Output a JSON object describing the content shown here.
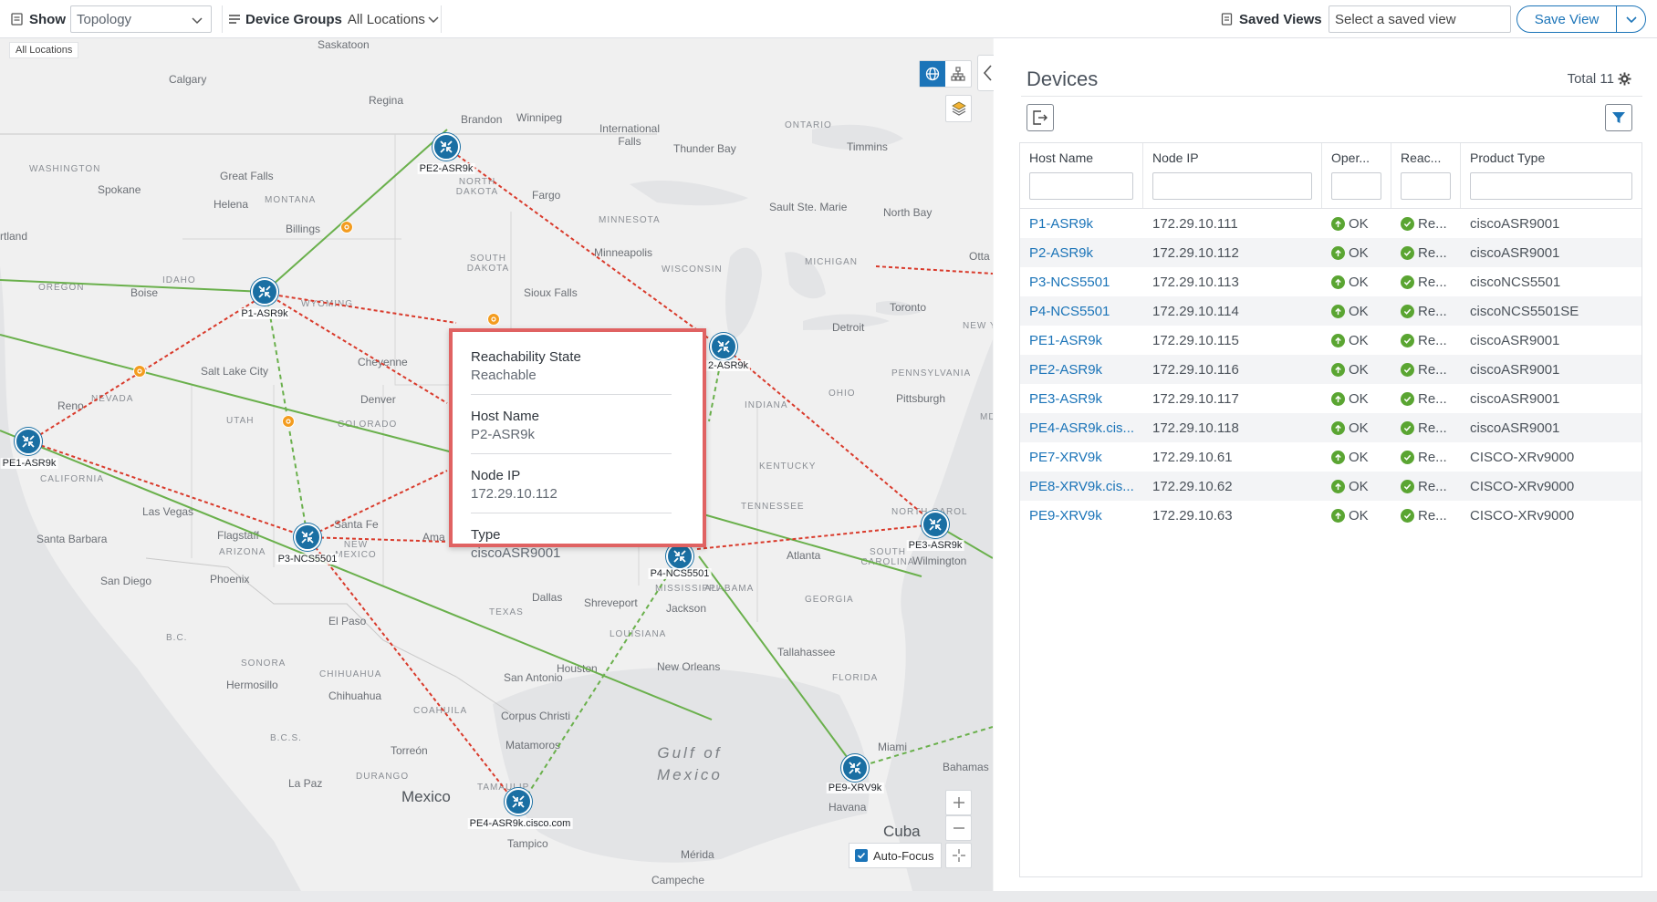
{
  "toolbar": {
    "show_label": "Show",
    "show_value": "Topology",
    "device_groups_label": "Device Groups",
    "device_groups_value": "All Locations",
    "saved_views_label": "Saved Views",
    "saved_view_placeholder": "Select a saved view",
    "save_view_label": "Save View"
  },
  "map": {
    "all_locations_badge": "All Locations",
    "auto_focus_label": "Auto-Focus",
    "auto_focus_checked": true,
    "places": {
      "saskatoon": "Saskatoon",
      "calgary": "Calgary",
      "regina": "Regina",
      "brandon": "Brandon",
      "winnipeg": "Winnipeg",
      "ontario": "ONTARIO",
      "intl_falls": "International Falls",
      "thunder_bay": "Thunder Bay",
      "timmins": "Timmins",
      "washington": "WASHINGTON",
      "spokane": "Spokane",
      "great_falls": "Great Falls",
      "helena": "Helena",
      "montana": "MONTANA",
      "north_dakota": "NORTH DAKOTA",
      "fargo": "Fargo",
      "minnesota": "MINNESOTA",
      "sault": "Sault Ste. Marie",
      "north_bay": "North Bay",
      "billings": "Billings",
      "portland": "rtland",
      "ottawa": "Otta",
      "oregon": "OREGON",
      "idaho": "IDAHO",
      "boise": "Boise",
      "wyoming": "WYOMING",
      "south_dakota": "SOUTH DAKOTA",
      "sioux_falls": "Sioux Falls",
      "minneapolis": "Minneapolis",
      "wisconsin": "WISCONSIN",
      "michigan": "MICHIGAN",
      "toronto": "Toronto",
      "detroit": "Detroit",
      "new_y": "NEW Y",
      "salt_lake": "Salt Lake City",
      "cheyenne": "Cheyenne",
      "nevada": "NEVADA",
      "reno": "Reno",
      "utah": "UTAH",
      "denver": "Denver",
      "colorado": "COLORADO",
      "pennsylvania": "PENNSYLVANIA",
      "ohio": "OHIO",
      "pittsburgh": "Pittsburgh",
      "indiana": "INDIANA",
      "md": "MD",
      "kentucky": "KENTUCKY",
      "california": "CALIFORNIA",
      "las_vegas": "Las Vegas",
      "flagstaff": "Flagstaff",
      "arizona": "ARIZONA",
      "santa_fe": "Santa Fe",
      "new_mexico": "NEW MEXICO",
      "amarillo": "Ama",
      "tennessee": "TENNESSEE",
      "north_carolina": "NORTH CAROL",
      "santa_barbara": "Santa Barbara",
      "phoenix": "Phoenix",
      "san_diego": "San Diego",
      "atlanta": "Atlanta",
      "south_carolina": "SOUTH CAROLINA",
      "wilmington": "Wilmington",
      "alabama": "ALABAMA",
      "mississippi": "MISSISSIPPI",
      "dallas": "Dallas",
      "shreveport": "Shreveport",
      "jackson": "Jackson",
      "georgia": "GEORGIA",
      "el_paso": "El Paso",
      "texas": "TEXAS",
      "louisiana": "LOUISIANA",
      "tallahassee": "Tallahassee",
      "bc": "B.C.",
      "sonora": "SONORA",
      "chihuahua_state": "CHIHUAHUA",
      "houston": "Houston",
      "new_orleans": "New Orleans",
      "hermosillo": "Hermosillo",
      "chihuahua": "Chihuahua",
      "san_antonio": "San Antonio",
      "florida": "FLORIDA",
      "coahuila": "COAHUILA",
      "corpus": "Corpus Christi",
      "gulf": "Gulf of\nMexico",
      "bcs": "B.C.S.",
      "torreon": "Torreón",
      "matamoros": "Matamoros",
      "miami": "Miami",
      "bahamas": "Bahamas",
      "durango": "DURANGO",
      "la_paz": "La Paz",
      "mexico": "Mexico",
      "tamaulipas": "TAMAULIP",
      "havana": "Havana",
      "cuba": "Cuba",
      "tampico": "Tampico",
      "merida": "Mérida",
      "campeche": "Campeche"
    },
    "nodes": [
      {
        "id": "pe2",
        "label": "PE2-ASR9k"
      },
      {
        "id": "p1",
        "label": "P1-ASR9k"
      },
      {
        "id": "p2",
        "label": "2-ASR9k"
      },
      {
        "id": "pe1",
        "label": "PE1-ASR9k"
      },
      {
        "id": "p3",
        "label": "P3-NCS5501"
      },
      {
        "id": "p4",
        "label": "P4-NCS5501"
      },
      {
        "id": "pe3",
        "label": "PE3-ASR9k"
      },
      {
        "id": "pe9",
        "label": "PE9-XRV9k"
      },
      {
        "id": "pe4",
        "label": "PE4-ASR9k.cisco.com"
      }
    ],
    "tooltip": [
      {
        "key": "Reachability State",
        "value": "Reachable"
      },
      {
        "key": "Host Name",
        "value": "P2-ASR9k"
      },
      {
        "key": "Node IP",
        "value": "172.29.10.112"
      },
      {
        "key": "Type",
        "value": "ciscoASR9001"
      }
    ]
  },
  "devices": {
    "title": "Devices",
    "total_label": "Total 11",
    "columns": [
      "Host Name",
      "Node IP",
      "Oper...",
      "Reac...",
      "Product Type"
    ],
    "rows": [
      {
        "host": "P1-ASR9k",
        "ip": "172.29.10.111",
        "oper": "OK",
        "reach": "Re...",
        "type": "ciscoASR9001"
      },
      {
        "host": "P2-ASR9k",
        "ip": "172.29.10.112",
        "oper": "OK",
        "reach": "Re...",
        "type": "ciscoASR9001"
      },
      {
        "host": "P3-NCS5501",
        "ip": "172.29.10.113",
        "oper": "OK",
        "reach": "Re...",
        "type": "ciscoNCS5501"
      },
      {
        "host": "P4-NCS5501",
        "ip": "172.29.10.114",
        "oper": "OK",
        "reach": "Re...",
        "type": "ciscoNCS5501SE"
      },
      {
        "host": "PE1-ASR9k",
        "ip": "172.29.10.115",
        "oper": "OK",
        "reach": "Re...",
        "type": "ciscoASR9001"
      },
      {
        "host": "PE2-ASR9k",
        "ip": "172.29.10.116",
        "oper": "OK",
        "reach": "Re...",
        "type": "ciscoASR9001"
      },
      {
        "host": "PE3-ASR9k",
        "ip": "172.29.10.117",
        "oper": "OK",
        "reach": "Re...",
        "type": "ciscoASR9001"
      },
      {
        "host": "PE4-ASR9k.cis...",
        "ip": "172.29.10.118",
        "oper": "OK",
        "reach": "Re...",
        "type": "ciscoASR9001"
      },
      {
        "host": "PE7-XRV9k",
        "ip": "172.29.10.61",
        "oper": "OK",
        "reach": "Re...",
        "type": "CISCO-XRv9000"
      },
      {
        "host": "PE8-XRV9k.cis...",
        "ip": "172.29.10.62",
        "oper": "OK",
        "reach": "Re...",
        "type": "CISCO-XRv9000"
      },
      {
        "host": "PE9-XRV9k",
        "ip": "172.29.10.63",
        "oper": "OK",
        "reach": "Re...",
        "type": "CISCO-XRv9000"
      }
    ]
  },
  "colors": {
    "accent": "#1b74b8",
    "node": "#1a6fa3",
    "link_up": "#6ab04c",
    "link_down": "#d93a2b",
    "ok": "#5aa532",
    "tooltip_border": "#e06262"
  }
}
